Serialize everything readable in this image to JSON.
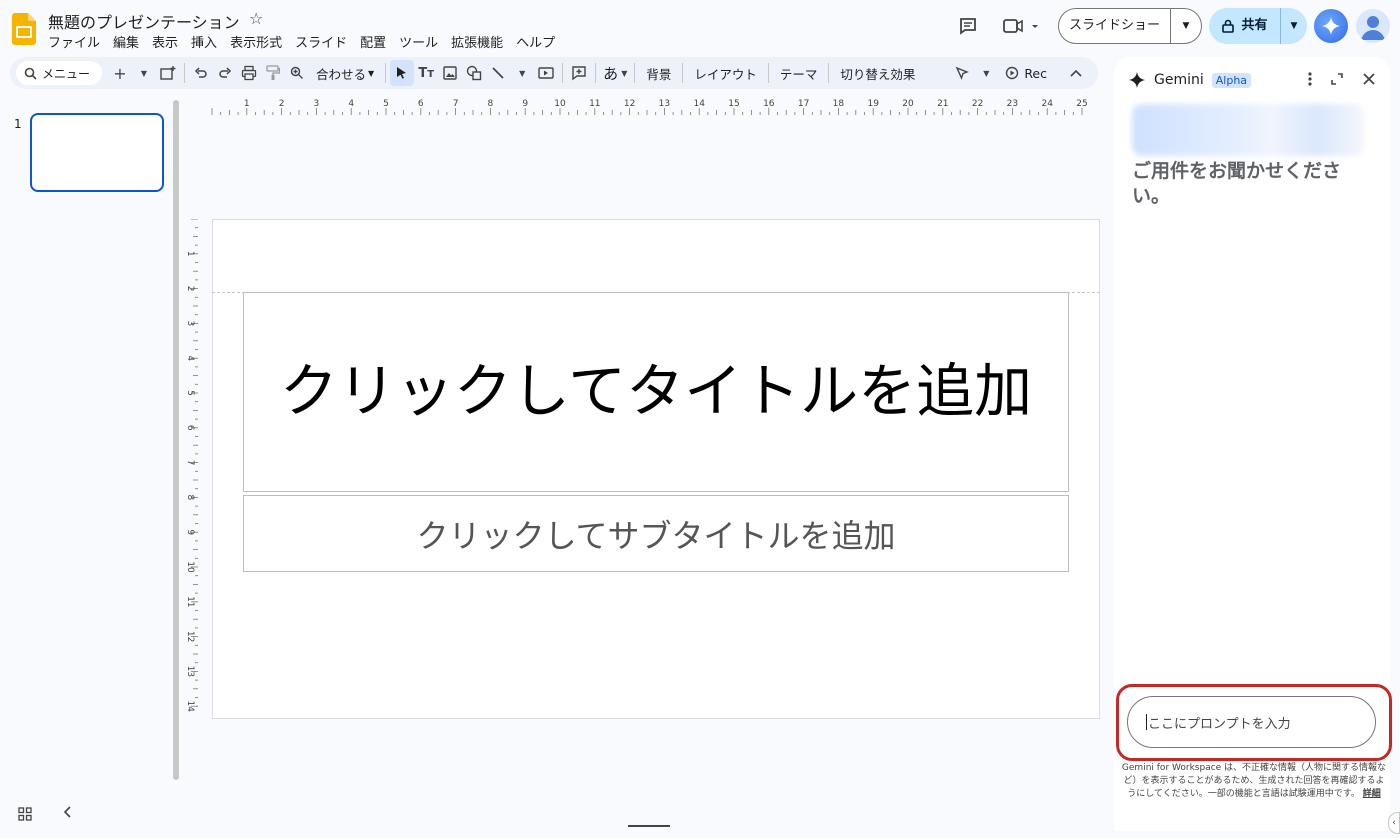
{
  "header": {
    "title": "無題のプレゼンテーション",
    "menus": [
      "ファイル",
      "編集",
      "表示",
      "挿入",
      "表示形式",
      "スライド",
      "配置",
      "ツール",
      "拡張機能",
      "ヘルプ"
    ],
    "slideshow_label": "スライドショー",
    "share_label": "共有"
  },
  "toolbar": {
    "menu_label": "メニュー",
    "zoom_label": "合わせる",
    "background_label": "背景",
    "layout_label": "レイアウト",
    "theme_label": "テーマ",
    "transition_label": "切り替え効果",
    "rec_label": "Rec",
    "input_mode_label": "あ"
  },
  "filmstrip": {
    "slide_number": "1"
  },
  "ruler": {
    "horizontal": [
      "1",
      "2",
      "3",
      "4",
      "5",
      "6",
      "7",
      "8",
      "9",
      "10",
      "11",
      "12",
      "13",
      "14",
      "15",
      "16",
      "17",
      "18",
      "19",
      "20",
      "21",
      "22",
      "23",
      "24",
      "25"
    ],
    "vertical": [
      "1",
      "2",
      "3",
      "4",
      "5",
      "6",
      "7",
      "8",
      "9",
      "10",
      "11",
      "12",
      "13",
      "14"
    ]
  },
  "slide": {
    "title_placeholder": "クリックしてタイトルを追加",
    "subtitle_placeholder": "クリックしてサブタイトルを追加"
  },
  "gemini": {
    "name": "Gemini",
    "badge": "Alpha",
    "greeting": "ご用件をお聞かせください。",
    "prompt_placeholder": "ここにプロンプトを入力",
    "disclaimer": "Gemini for Workspace は、不正確な情報（人物に関する情報など）を表示することがあるため、生成された回答を再確認するようにしてください。一部の機能と言語は試験運用中です。",
    "disclaimer_link": "詳細"
  },
  "colors": {
    "accent": "#0b57d0",
    "share_bg": "#c2e7ff",
    "highlight": "#c62828",
    "slides_yellow": "#f4b400"
  }
}
